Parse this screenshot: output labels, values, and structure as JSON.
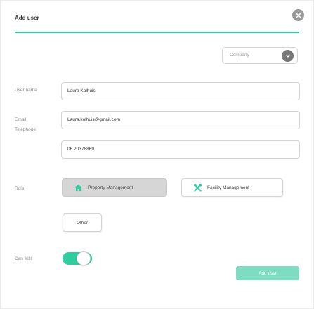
{
  "dialog": {
    "title": "Add user",
    "close_icon": "close-icon"
  },
  "company": {
    "value": "Company",
    "icon": "chevron-down-icon"
  },
  "fields": {
    "username": {
      "label": "User name",
      "value": "Laura Kolhuis"
    },
    "email": {
      "label": "Email",
      "value": "Laura.kolhuis@gmail.com"
    },
    "telephone": {
      "label": "Telephone",
      "value": "06 20378869"
    }
  },
  "role": {
    "label": "Role",
    "options": [
      {
        "label": "Property Management",
        "icon": "home-icon",
        "selected": true
      },
      {
        "label": "Facility Management",
        "icon": "tools-icon",
        "selected": false
      },
      {
        "label": "Other",
        "icon": "",
        "selected": false
      }
    ]
  },
  "can_edit": {
    "label": "Can edit",
    "enabled": true
  },
  "submit": {
    "label": "Add user"
  },
  "colors": {
    "accent": "#2ecc9f",
    "accent_light": "#7fdcc2",
    "selected_bg": "#d6d6d6"
  }
}
